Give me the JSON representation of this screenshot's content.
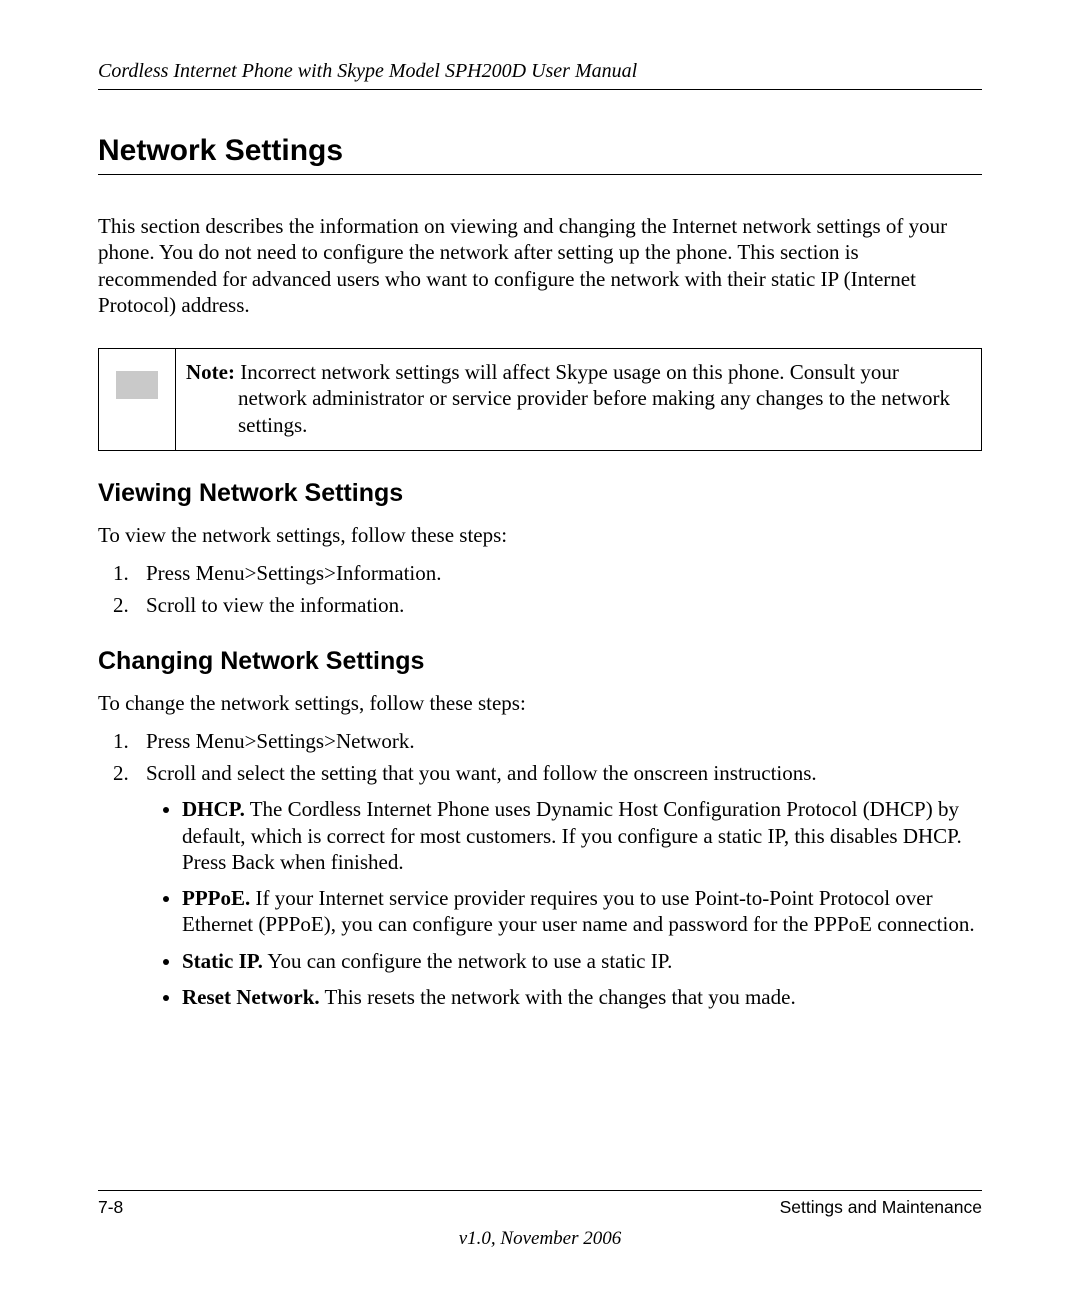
{
  "header": {
    "running_title": "Cordless Internet Phone with Skype Model SPH200D User Manual"
  },
  "section": {
    "title": "Network Settings",
    "intro": "This section describes the information on viewing and changing the Internet network settings of your phone. You do not need to configure the network after setting up the phone. This section is recommended for advanced users who want to configure the network with their static IP (Internet Protocol) address."
  },
  "note": {
    "label": "Note:",
    "first_line": " Incorrect network settings will affect Skype usage on this phone. Consult your",
    "rest": "network administrator or service provider before making any changes to the network settings."
  },
  "viewing": {
    "heading": "Viewing Network Settings",
    "lead": "To view the network settings, follow these steps:",
    "steps": [
      "Press Menu>Settings>Information.",
      "Scroll to view the information."
    ]
  },
  "changing": {
    "heading": "Changing Network Settings",
    "lead": "To change the network settings, follow these steps:",
    "steps": [
      "Press Menu>Settings>Network.",
      "Scroll and select the setting that you want, and follow the onscreen instructions."
    ],
    "bullets": [
      {
        "term": "DHCP.",
        "desc": " The Cordless Internet Phone uses Dynamic Host Configuration Protocol (DHCP) by default, which is correct for most customers. If you configure a static IP, this disables DHCP. Press Back when finished."
      },
      {
        "term": "PPPoE.",
        "desc": " If your Internet service provider requires you to use Point-to-Point Protocol over Ethernet (PPPoE), you can configure your user name and password for the PPPoE connection."
      },
      {
        "term": "Static IP.",
        "desc": " You can configure the network to use a static IP."
      },
      {
        "term": "Reset Network.",
        "desc": " This resets the network with the changes that you made."
      }
    ]
  },
  "footer": {
    "page_number": "7-8",
    "section_name": "Settings and Maintenance",
    "version": "v1.0, November 2006"
  }
}
